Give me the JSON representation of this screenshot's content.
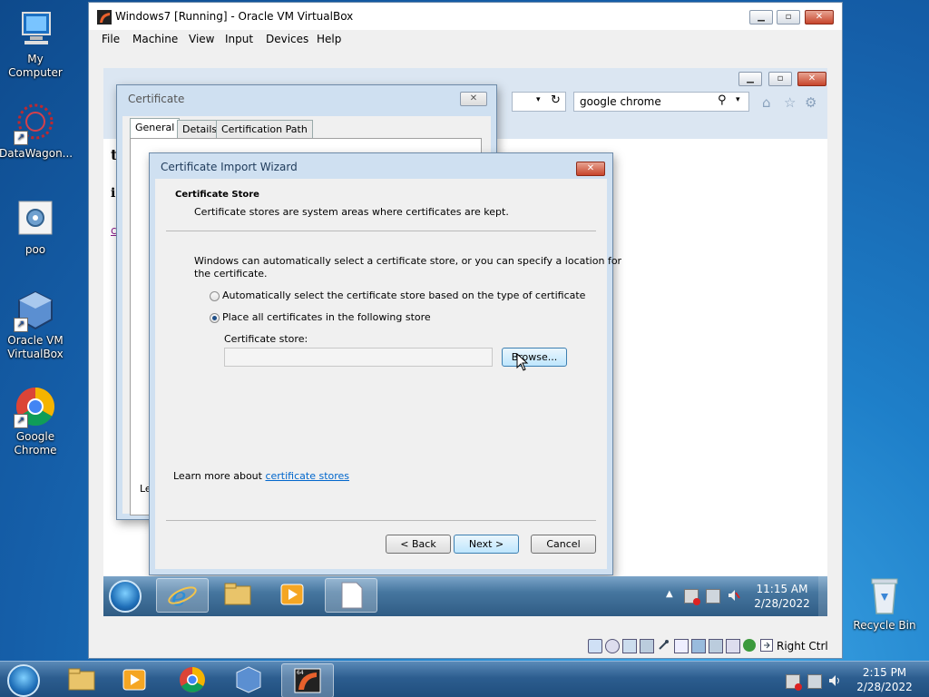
{
  "desktop": {
    "icons": [
      {
        "label": "My Computer"
      },
      {
        "label": "DataWagon..."
      },
      {
        "label": "poo"
      },
      {
        "label": "Oracle VM VirtualBox"
      },
      {
        "label": "Google Chrome"
      },
      {
        "label": "Recycle Bin"
      }
    ]
  },
  "host_taskbar": {
    "time": "2:15 PM",
    "date": "2/28/2022"
  },
  "vbox": {
    "title": "Windows7 [Running] - Oracle VM VirtualBox",
    "menu": [
      "File",
      "Machine",
      "View",
      "Input",
      "Devices",
      "Help"
    ],
    "status_host_key": "Right Ctrl"
  },
  "ie": {
    "search_value": "google chrome",
    "page_fragments": [
      "ti",
      "i",
      "c"
    ]
  },
  "cert_dialog": {
    "title": "Certificate",
    "tabs": [
      "General",
      "Details",
      "Certification Path"
    ],
    "footer_fragment": "Le"
  },
  "wizard": {
    "title": "Certificate Import Wizard",
    "heading": "Certificate Store",
    "subheading": "Certificate stores are system areas where certificates are kept.",
    "description_line1": "Windows can automatically select a certificate store, or you can specify a location for",
    "description_line2": "the certificate.",
    "option_auto": "Automatically select the certificate store based on the type of certificate",
    "option_manual": "Place all certificates in the following store",
    "store_label": "Certificate store:",
    "store_value": "",
    "browse_label": "Browse...",
    "learn_more_prefix": "Learn more about ",
    "learn_more_link": "certificate stores",
    "back_label": "< Back",
    "next_label": "Next >",
    "cancel_label": "Cancel",
    "selected_option": "manual"
  },
  "guest_taskbar": {
    "time": "11:15 AM",
    "date": "2/28/2022"
  },
  "colors": {
    "link": "#0066cc",
    "title_text": "#1e3a5a"
  }
}
